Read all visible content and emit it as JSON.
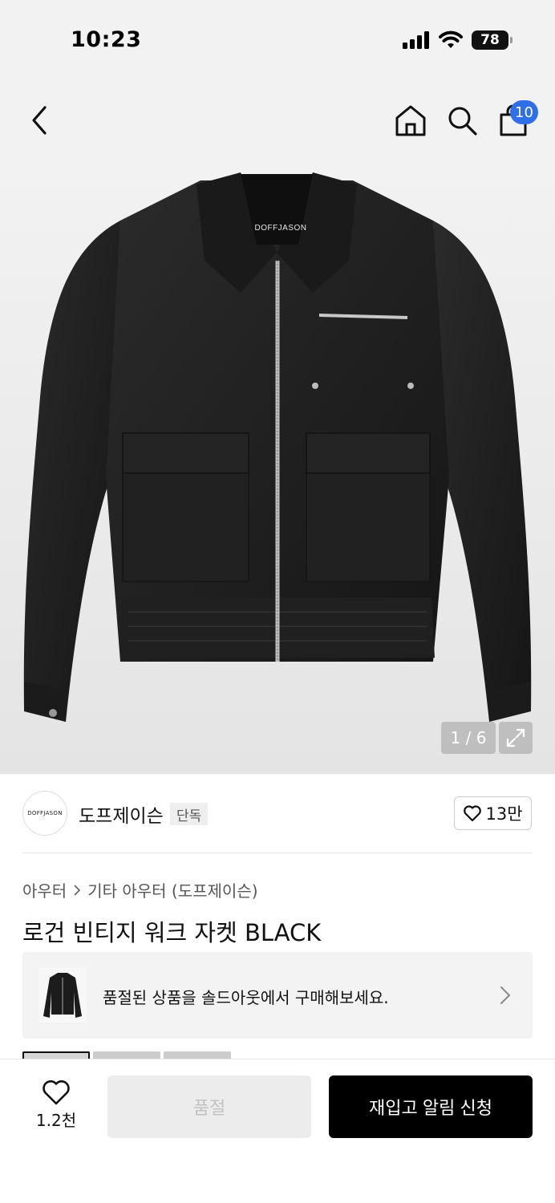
{
  "status_bar": {
    "time": "10:23",
    "battery": "78",
    "icons": [
      "signal-icon",
      "wifi-icon",
      "battery-icon"
    ]
  },
  "nav": {
    "icons": [
      "back-chevron-icon",
      "home-icon",
      "search-icon",
      "shopping-bag-icon"
    ],
    "cart_count": "10"
  },
  "product_image": {
    "brand_label": "DOFFJASON",
    "counter": "1 / 6"
  },
  "brand": {
    "logo_text": "DOFFJASON",
    "name": "도프제이슨",
    "badge": "단독",
    "likes": "13만"
  },
  "breadcrumb": {
    "category": "아우터",
    "subcategory": "기타 아우터 (도프제이슨)"
  },
  "product": {
    "title": "로건 빈티지 워크 자켓 BLACK"
  },
  "soldout_banner": {
    "text": "품절된 상품을 솔드아웃에서 구매해보세요."
  },
  "bottom_bar": {
    "wish_count": "1.2천",
    "soldout_label": "품절",
    "restock_label": "재입고 알림 신청"
  },
  "colors": {
    "accent": "#2f6fe8",
    "primary_button": "#000000",
    "disabled_button": "#ececec"
  }
}
